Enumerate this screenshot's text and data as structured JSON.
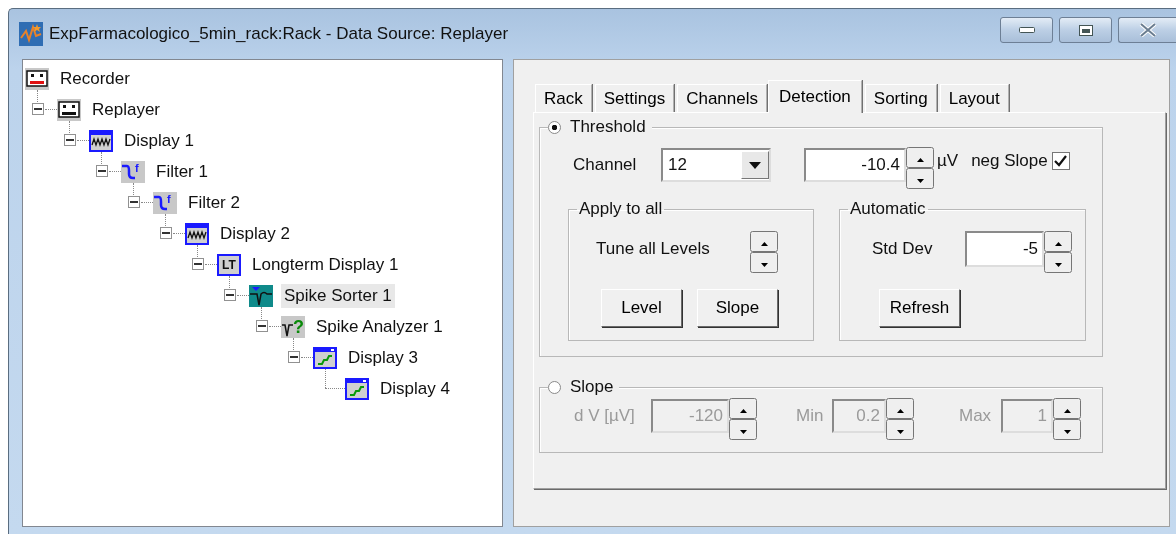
{
  "window": {
    "title": "ExpFarmacologico_5min_rack:Rack - Data Source: Replayer"
  },
  "tree": [
    {
      "label": "Recorder",
      "kind": "recorder",
      "selected": false,
      "children": [
        {
          "label": "Replayer",
          "kind": "replayer",
          "expanded": true,
          "selected": false,
          "children": [
            {
              "label": "Display 1",
              "kind": "display",
              "expanded": true,
              "selected": false,
              "children": [
                {
                  "label": "Filter 1",
                  "kind": "filter",
                  "badge": "f",
                  "expanded": true,
                  "selected": false,
                  "children": [
                    {
                      "label": "Filter 2",
                      "kind": "filter",
                      "badge": "f",
                      "expanded": true,
                      "selected": false,
                      "children": [
                        {
                          "label": "Display 2",
                          "kind": "display",
                          "expanded": true,
                          "selected": false,
                          "children": [
                            {
                              "label": "Longterm Display 1",
                              "kind": "longterm",
                              "badge": "LT",
                              "expanded": true,
                              "selected": false,
                              "children": [
                                {
                                  "label": "Spike Sorter 1",
                                  "kind": "sorter",
                                  "expanded": true,
                                  "selected": true,
                                  "children": [
                                    {
                                      "label": "Spike Analyzer 1",
                                      "kind": "analyzer",
                                      "badge": "?",
                                      "expanded": true,
                                      "selected": false,
                                      "children": [
                                        {
                                          "label": "Display 3",
                                          "kind": "scope",
                                          "expanded": true,
                                          "selected": false,
                                          "children": [
                                            {
                                              "label": "Display 4",
                                              "kind": "scope",
                                              "selected": false
                                            }
                                          ]
                                        }
                                      ]
                                    }
                                  ]
                                }
                              ]
                            }
                          ]
                        }
                      ]
                    }
                  ]
                }
              ]
            }
          ]
        }
      ]
    }
  ],
  "tabs": [
    {
      "label": "Rack",
      "selected": false
    },
    {
      "label": "Settings",
      "selected": false
    },
    {
      "label": "Channels",
      "selected": false
    },
    {
      "label": "Detection",
      "selected": true
    },
    {
      "label": "Sorting",
      "selected": false
    },
    {
      "label": "Layout",
      "selected": false
    }
  ],
  "threshold": {
    "label": "Threshold",
    "selected": true,
    "channel_label": "Channel",
    "channel": "12",
    "value": "-10.4",
    "unit": "µV",
    "neg_slope": {
      "label": "neg Slope",
      "checked": true
    },
    "apply_to_all": {
      "title": "Apply to all",
      "tune_label": "Tune all Levels",
      "buttons": [
        "Level",
        "Slope"
      ]
    },
    "automatic": {
      "title": "Automatic",
      "std_dev_label": "Std Dev",
      "std_dev": "-5",
      "button": "Refresh"
    }
  },
  "slope": {
    "label": "Slope",
    "selected": false,
    "disabled": true,
    "fields": [
      {
        "label": "d V [µV]",
        "value": "-120"
      },
      {
        "label": "Min",
        "value": "0.2"
      },
      {
        "label": "Max",
        "value": "1"
      }
    ]
  }
}
